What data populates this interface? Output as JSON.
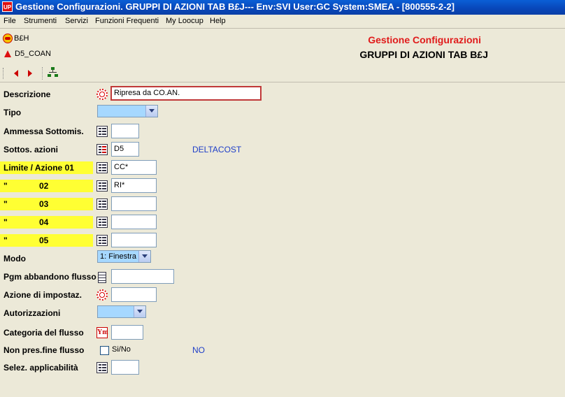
{
  "window": {
    "app_icon": "UP",
    "title": "Gestione Configurazioni. GRUPPI DI AZIONI TAB B£J--- Env:SVI User:GC System:SMEA - [800555-2-2]"
  },
  "menu": [
    "File",
    "Strumenti",
    "Servizi",
    "Funzioni Frequenti",
    "My Loocup",
    "Help"
  ],
  "header": {
    "item1": "B£H",
    "item2": "D5_COAN",
    "title1": "Gestione Configurazioni",
    "title2": "GRUPPI DI AZIONI TAB B£J",
    "title1_color": "#e01b1b"
  },
  "toolbar": {
    "icons": [
      "prev-arrow-icon",
      "next-arrow-icon",
      "tree-icon"
    ]
  },
  "form": {
    "descrizione": {
      "label": "Descrizione",
      "value": "Ripresa da CO.AN."
    },
    "tipo": {
      "label": "Tipo",
      "value": ""
    },
    "ammessa": {
      "label": "Ammessa  Sottomis.",
      "value": ""
    },
    "sottos": {
      "label": "Sottos. azioni",
      "value": "D5",
      "desc": "DELTACOST"
    },
    "limite1": {
      "label": "Limite / Azione 01",
      "value": "CC*"
    },
    "limite2": {
      "quote": "\"",
      "num": "02",
      "value": "RI*"
    },
    "limite3": {
      "quote": "\"",
      "num": "03",
      "value": ""
    },
    "limite4": {
      "quote": "\"",
      "num": "04",
      "value": ""
    },
    "limite5": {
      "quote": "\"",
      "num": "05",
      "value": ""
    },
    "modo": {
      "label": "Modo",
      "value": "1: Finestra"
    },
    "pgm": {
      "label": "Pgm abbandono flusso",
      "value": ""
    },
    "azione": {
      "label": "Azione di impostaz.",
      "value": ""
    },
    "autorizzazioni": {
      "label": "Autorizzazioni",
      "value": ""
    },
    "categoria": {
      "label": "Categoria del flusso",
      "value": ""
    },
    "nonpres": {
      "label": "Non pres.fine flusso",
      "checkbox_label": "Si/No",
      "desc": "NO",
      "checked": false
    },
    "selez": {
      "label": "Selez. applicabilità",
      "value": ""
    }
  },
  "colors": {
    "highlight": "#ffff33",
    "accent_blue": "#1e3ec8",
    "combo_fill": "#a6d8ff"
  }
}
